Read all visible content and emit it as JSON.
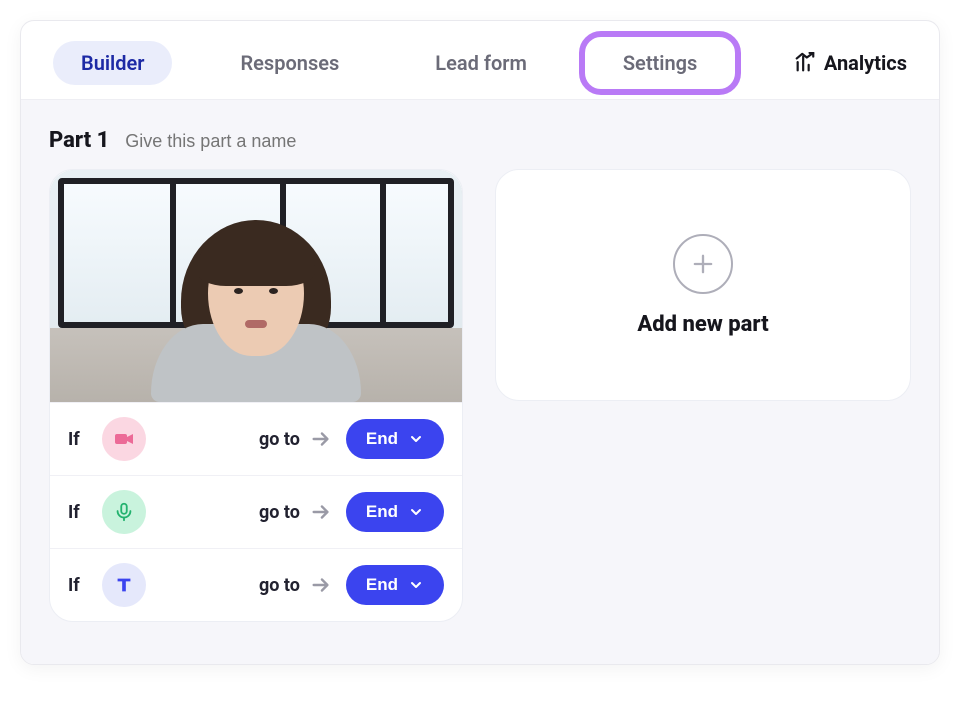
{
  "tabs": {
    "builder": "Builder",
    "responses": "Responses",
    "leadform": "Lead form",
    "settings": "Settings",
    "analytics": "Analytics"
  },
  "part": {
    "title": "Part 1",
    "name_placeholder": "Give this part a name",
    "name_value": ""
  },
  "rules": {
    "if_label": "If",
    "goto_label": "go to",
    "items": [
      {
        "type": "video",
        "destination": "End"
      },
      {
        "type": "audio",
        "destination": "End"
      },
      {
        "type": "text",
        "destination": "End"
      }
    ]
  },
  "add_card": {
    "label": "Add new part"
  },
  "colors": {
    "accent": "#3b44ef",
    "tab_active_bg": "#eaedfb",
    "highlight": "#b97af6"
  }
}
